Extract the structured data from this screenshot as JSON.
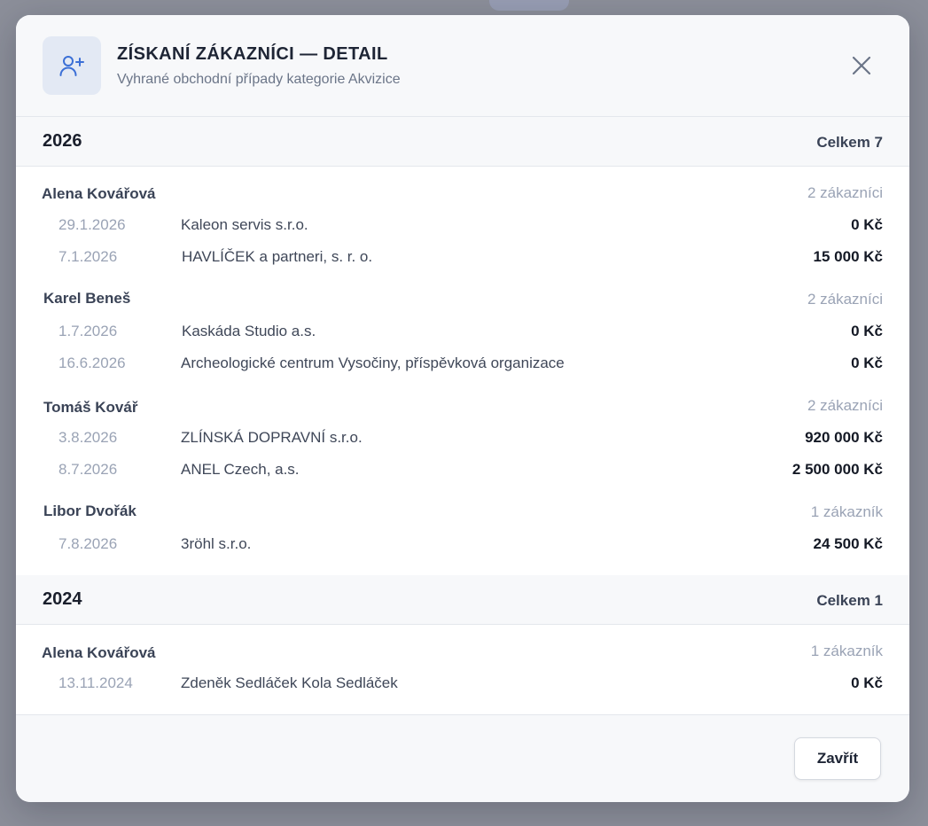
{
  "colors": {
    "accent": "#3b6fd6",
    "title": "#1e2535",
    "muted": "#9aa3b5",
    "header_bg": "#f7f8fa"
  },
  "modal": {
    "icon": "user-plus-icon",
    "title": "ZÍSKANÍ ZÁKAZNÍCI — DETAIL",
    "subtitle": "Vyhrané obchodní případy kategorie Akvizice",
    "close_icon": "close-icon"
  },
  "years": [
    {
      "year": "2026",
      "total": "Celkem 7",
      "people": [
        {
          "name": "Alena Kovářová",
          "count": "2 zákazníci",
          "rows": [
            {
              "date": "29.1.2026",
              "company": "Kaleon servis s.r.o.",
              "amount": "0 Kč"
            },
            {
              "date": "7.1.2026",
              "company": "HAVLÍČEK a partneri, s. r. o.",
              "amount": "15 000 Kč"
            }
          ]
        },
        {
          "name": "Karel Beneš",
          "count": "2 zákazníci",
          "rows": [
            {
              "date": "1.7.2026",
              "company": "Kaskáda Studio a.s.",
              "amount": "0 Kč"
            },
            {
              "date": "16.6.2026",
              "company": "Archeologické centrum Vysočiny, příspěvková organizace",
              "amount": "0 Kč"
            }
          ]
        },
        {
          "name": "Tomáš Kovář",
          "count": "2 zákazníci",
          "rows": [
            {
              "date": "3.8.2026",
              "company": "ZLÍNSKÁ DOPRAVNÍ s.r.o.",
              "amount": "920 000 Kč"
            },
            {
              "date": "8.7.2026",
              "company": "ANEL Czech, a.s.",
              "amount": "2 500 000 Kč"
            }
          ]
        },
        {
          "name": "Libor Dvořák",
          "count": "1 zákazník",
          "rows": [
            {
              "date": "7.8.2026",
              "company": "3röhl s.r.o.",
              "amount": "24 500 Kč"
            }
          ]
        }
      ]
    },
    {
      "year": "2024",
      "total": "Celkem 1",
      "people": [
        {
          "name": "Alena Kovářová",
          "count": "1 zákazník",
          "rows": [
            {
              "date": "13.11.2024",
              "company": "Zdeněk Sedláček Kola Sedláček",
              "amount": "0 Kč"
            }
          ]
        }
      ]
    }
  ],
  "footer": {
    "close_label": "Zavřít"
  }
}
